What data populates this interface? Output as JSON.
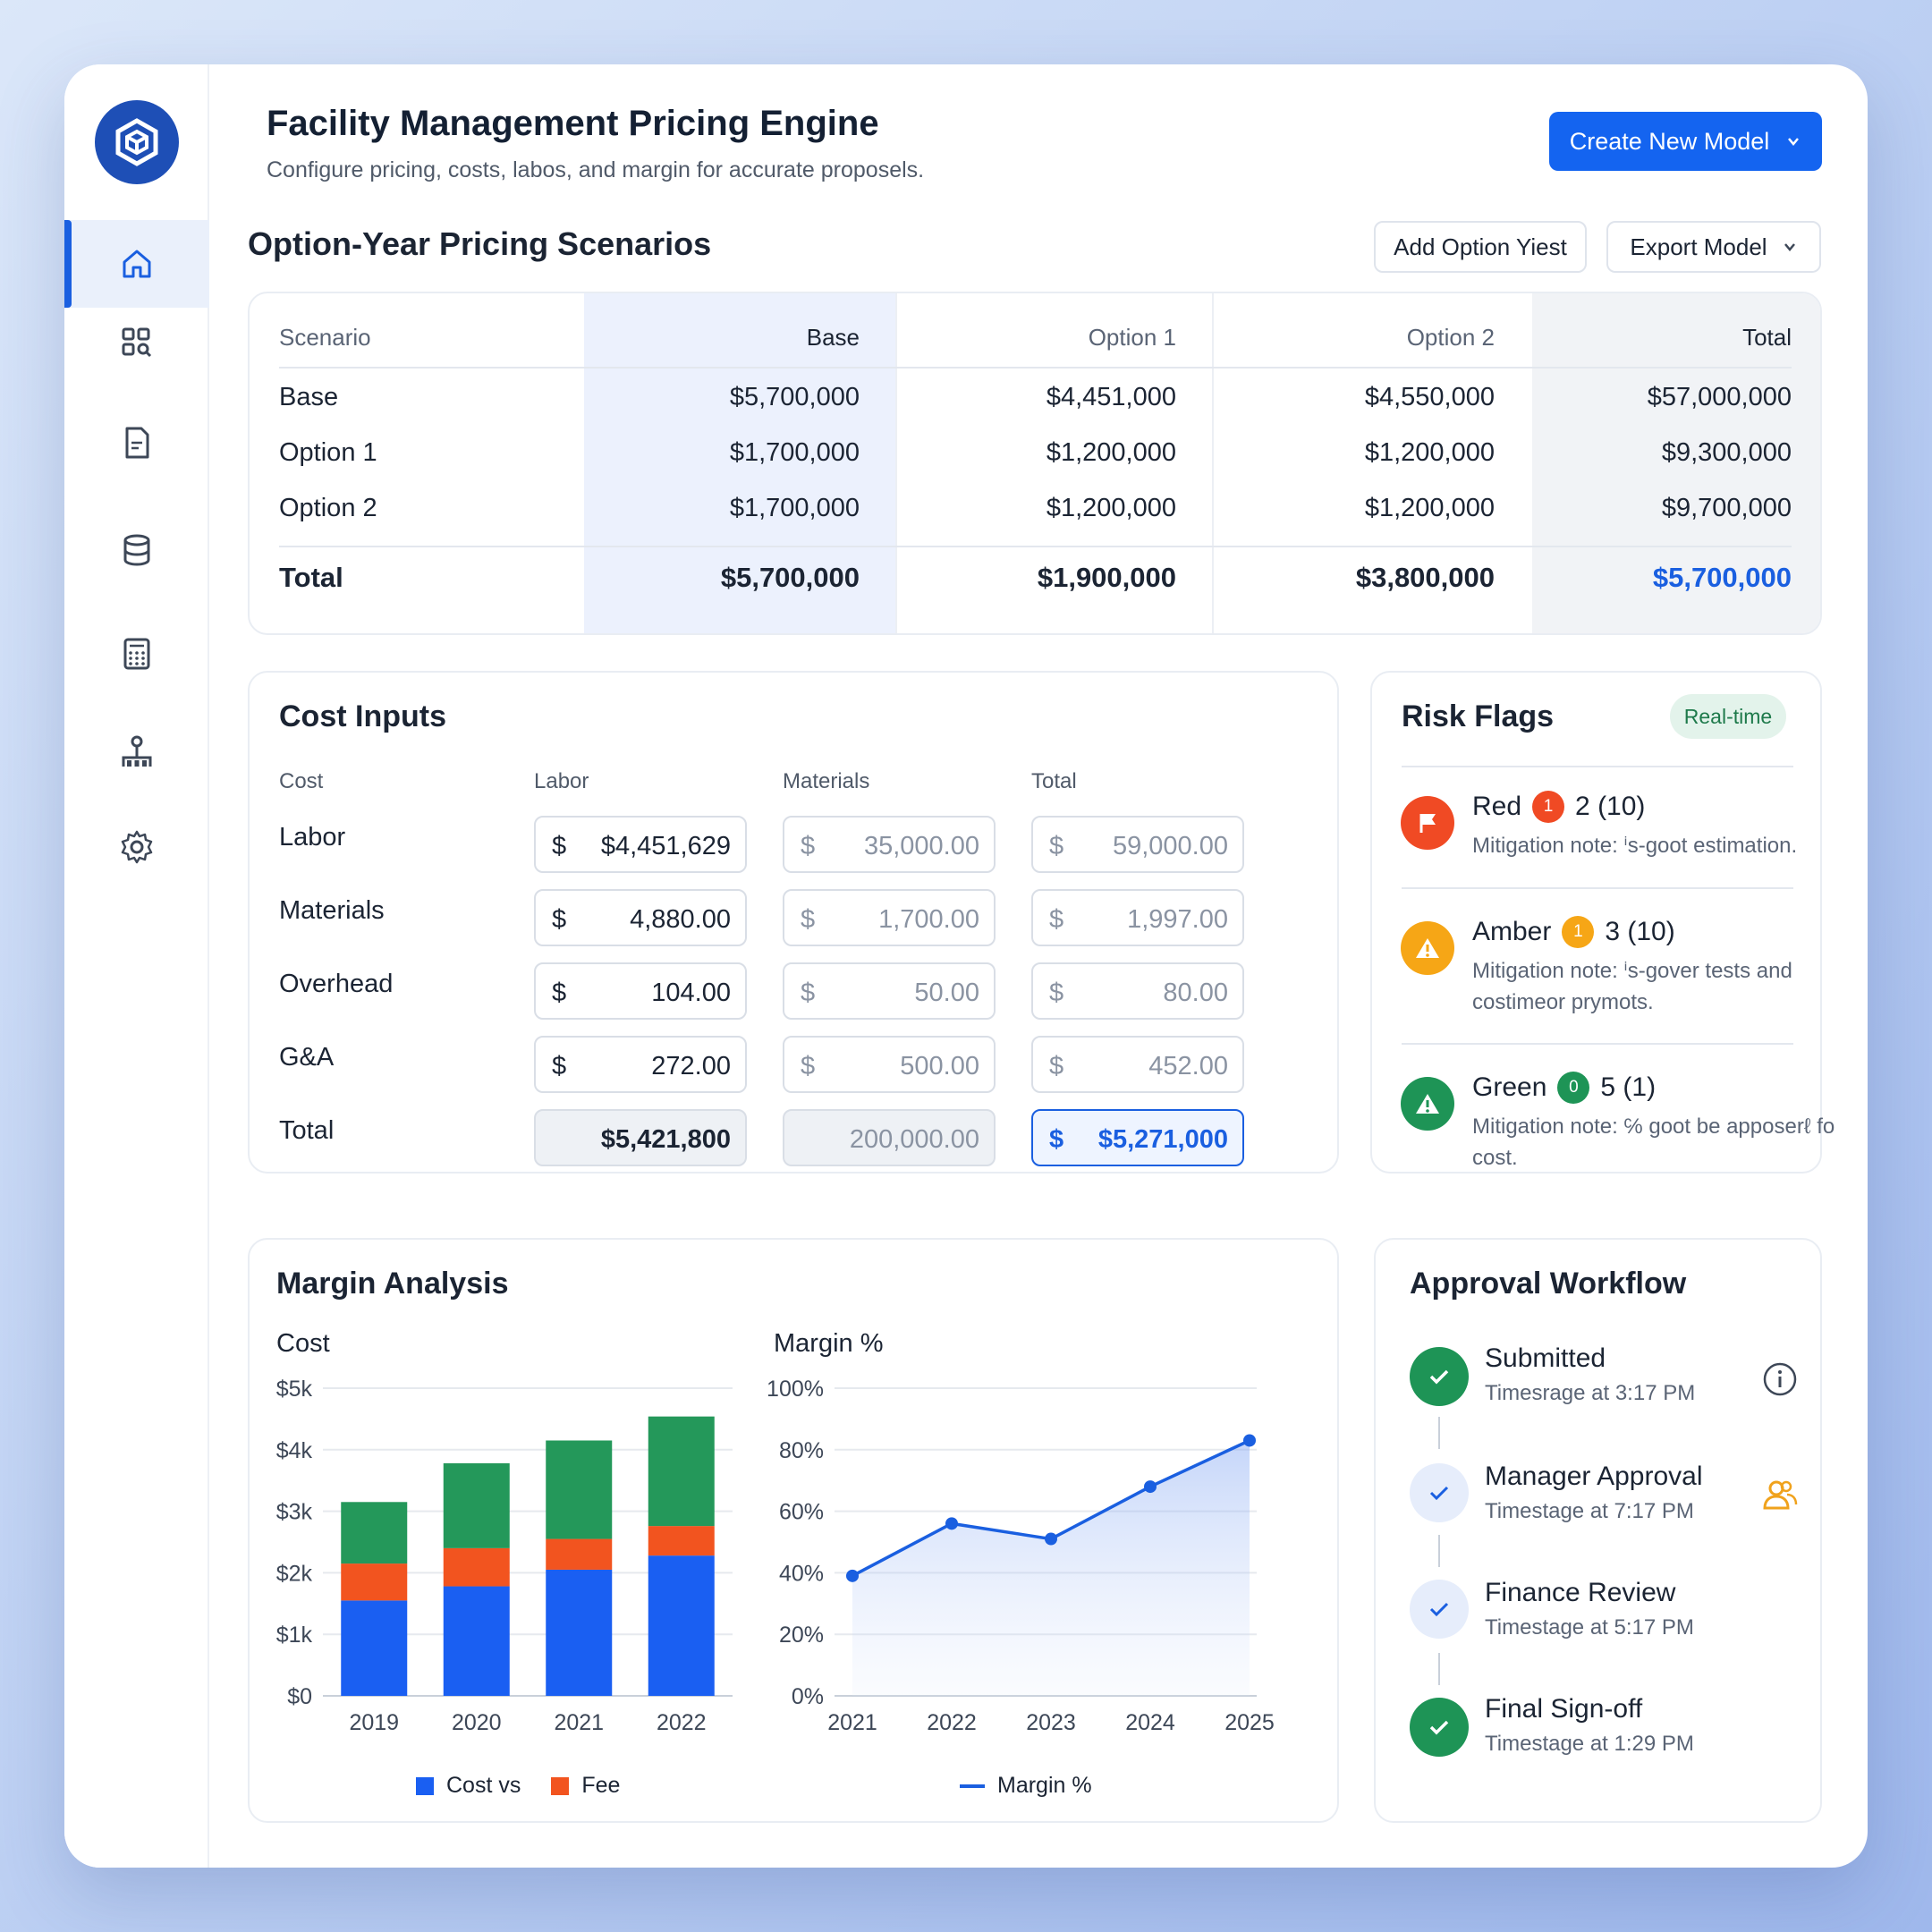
{
  "header": {
    "title": "Facility Management Pricing Engine",
    "subtitle": "Configure pricing, costs, labos, and margin for accurate proposels.",
    "create_button": "Create New Model"
  },
  "sidebar": {
    "items": [
      {
        "icon": "home-icon",
        "active": true
      },
      {
        "icon": "dashboard-search-icon",
        "active": false
      },
      {
        "icon": "document-icon",
        "active": false
      },
      {
        "icon": "database-icon",
        "active": false
      },
      {
        "icon": "calculator-icon",
        "active": false
      },
      {
        "icon": "org-chart-icon",
        "active": false
      },
      {
        "icon": "gear-icon",
        "active": false
      }
    ]
  },
  "pricing": {
    "title": "Option-Year Pricing Scenarios",
    "add_button": "Add Option Yiest",
    "export_button": "Export Model",
    "headers": [
      "Scenario",
      "Base",
      "Option 1",
      "Option 2",
      "Total"
    ],
    "rows": [
      [
        "Base",
        "$5,700,000",
        "$4,451,000",
        "$4,550,000",
        "$57,000,000"
      ],
      [
        "Option 1",
        "$1,700,000",
        "$1,200,000",
        "$1,200,000",
        "$9,300,000"
      ],
      [
        "Option 2",
        "$1,700,000",
        "$1,200,000",
        "$1,200,000",
        "$9,700,000"
      ]
    ],
    "total_row": [
      "Total",
      "$5,700,000",
      "$1,900,000",
      "$3,800,000",
      "$5,700,000"
    ]
  },
  "cost_inputs": {
    "title": "Cost Inputs",
    "headers": [
      "Cost",
      "Labor",
      "Materials",
      "Total"
    ],
    "currency": "$",
    "rows": [
      {
        "label": "Labor",
        "values": [
          "$4,451,629",
          "35,000.00",
          "59,000.00"
        ]
      },
      {
        "label": "Materials",
        "values": [
          "4,880.00",
          "1,700.00",
          "1,997.00"
        ]
      },
      {
        "label": "Overhead",
        "values": [
          "104.00",
          "50.00",
          "80.00"
        ]
      },
      {
        "label": "G&A",
        "values": [
          "272.00",
          "500.00",
          "452.00"
        ]
      }
    ],
    "total": {
      "label": "Total",
      "values": [
        "$5,421,800",
        "200,000.00",
        "$5,271,000"
      ]
    }
  },
  "risk": {
    "title": "Risk Flags",
    "badge": "Real-time",
    "items": [
      {
        "name": "Red",
        "count": "1",
        "detail": "2 (10)",
        "note": "Mitigation note: ⁱs-goot estimation.",
        "color": "#f04a24"
      },
      {
        "name": "Amber",
        "count": "1",
        "detail": "3 (10)",
        "note": "Mitigation note: ⁱs-gover tests and costimeor prymots.",
        "color": "#f6a616"
      },
      {
        "name": "Green",
        "count": "0",
        "detail": "5 (1)",
        "note": "Mitigation note: ℅ goot be apposerℓ fo cost.",
        "color": "#1e9456"
      }
    ]
  },
  "margin": {
    "title": "Margin Analysis",
    "legend_cost": "Cost vs",
    "legend_fee": "Fee",
    "legend_margin": "Margin %"
  },
  "chart_data": [
    {
      "type": "bar",
      "title": "Cost",
      "categories": [
        "2019",
        "2020",
        "2021",
        "2022"
      ],
      "series": [
        {
          "name": "Cost vs",
          "values": [
            1550,
            1780,
            2050,
            2280
          ],
          "color": "#1a5ff2"
        },
        {
          "name": "Fee",
          "values": [
            600,
            620,
            500,
            480
          ],
          "color": "#f2541f"
        },
        {
          "values": [
            1000,
            1380,
            1600,
            1780
          ],
          "color": "#24985a"
        }
      ],
      "y_ticks": [
        "$0",
        "$1k",
        "$2k",
        "$3k",
        "$4k",
        "$5k"
      ],
      "ylim": [
        0,
        5000
      ]
    },
    {
      "type": "line",
      "title": "Margin %",
      "x": [
        "2021",
        "2022",
        "2023",
        "2024",
        "2025"
      ],
      "series": [
        {
          "name": "Margin %",
          "values": [
            39,
            56,
            51,
            68,
            83
          ],
          "color": "#1a5fe0"
        }
      ],
      "y_ticks": [
        "0%",
        "20%",
        "40%",
        "60%",
        "80%",
        "100%"
      ],
      "ylim": [
        0,
        100
      ]
    }
  ],
  "workflow": {
    "title": "Approval Workflow",
    "steps": [
      {
        "title": "Submitted",
        "time": "Timesrage at 3:17 PM",
        "state": "done"
      },
      {
        "title": "Manager Approval",
        "time": "Timestage at 7:17 PM",
        "state": "pending"
      },
      {
        "title": "Finance Review",
        "time": "Timestage at 5:17 PM",
        "state": "pending"
      },
      {
        "title": "Final Sign-off",
        "time": "Timestage at 1:29 PM",
        "state": "done"
      }
    ]
  },
  "colors": {
    "accent": "#1464f0",
    "green": "#1e9456",
    "amber": "#f6a616",
    "red": "#f04a24"
  }
}
